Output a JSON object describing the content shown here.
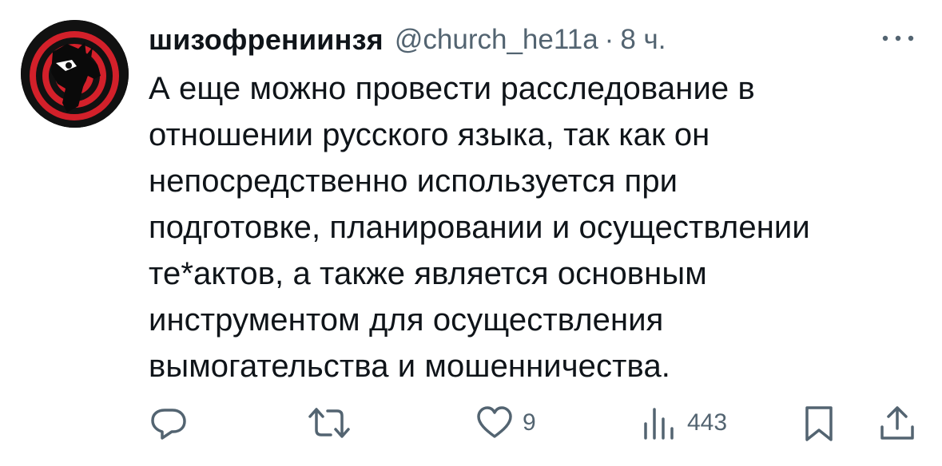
{
  "author": {
    "display_name": "шизофрениинзя",
    "handle": "@church_he11a",
    "separator": "·",
    "time": "8 ч."
  },
  "tweet": {
    "text": "А еще можно провести расследование в\nотношении русского языка, так как он\nнепосредственно используется при\nподготовке, планировании и осуществлении\nте*актов, а также является основным\nинструментом для осуществления\nвымогательства и мошенничества."
  },
  "actions": {
    "reply_icon": "reply-icon",
    "retweet_icon": "retweet-icon",
    "like_icon": "heart-icon",
    "like_count": "9",
    "views_icon": "views-icon",
    "views_count": "443",
    "bookmark_icon": "bookmark-icon",
    "share_icon": "share-icon"
  },
  "colors": {
    "text": "#0f1419",
    "secondary": "#536471",
    "avatar_red": "#d3202a",
    "avatar_dark": "#111111"
  }
}
